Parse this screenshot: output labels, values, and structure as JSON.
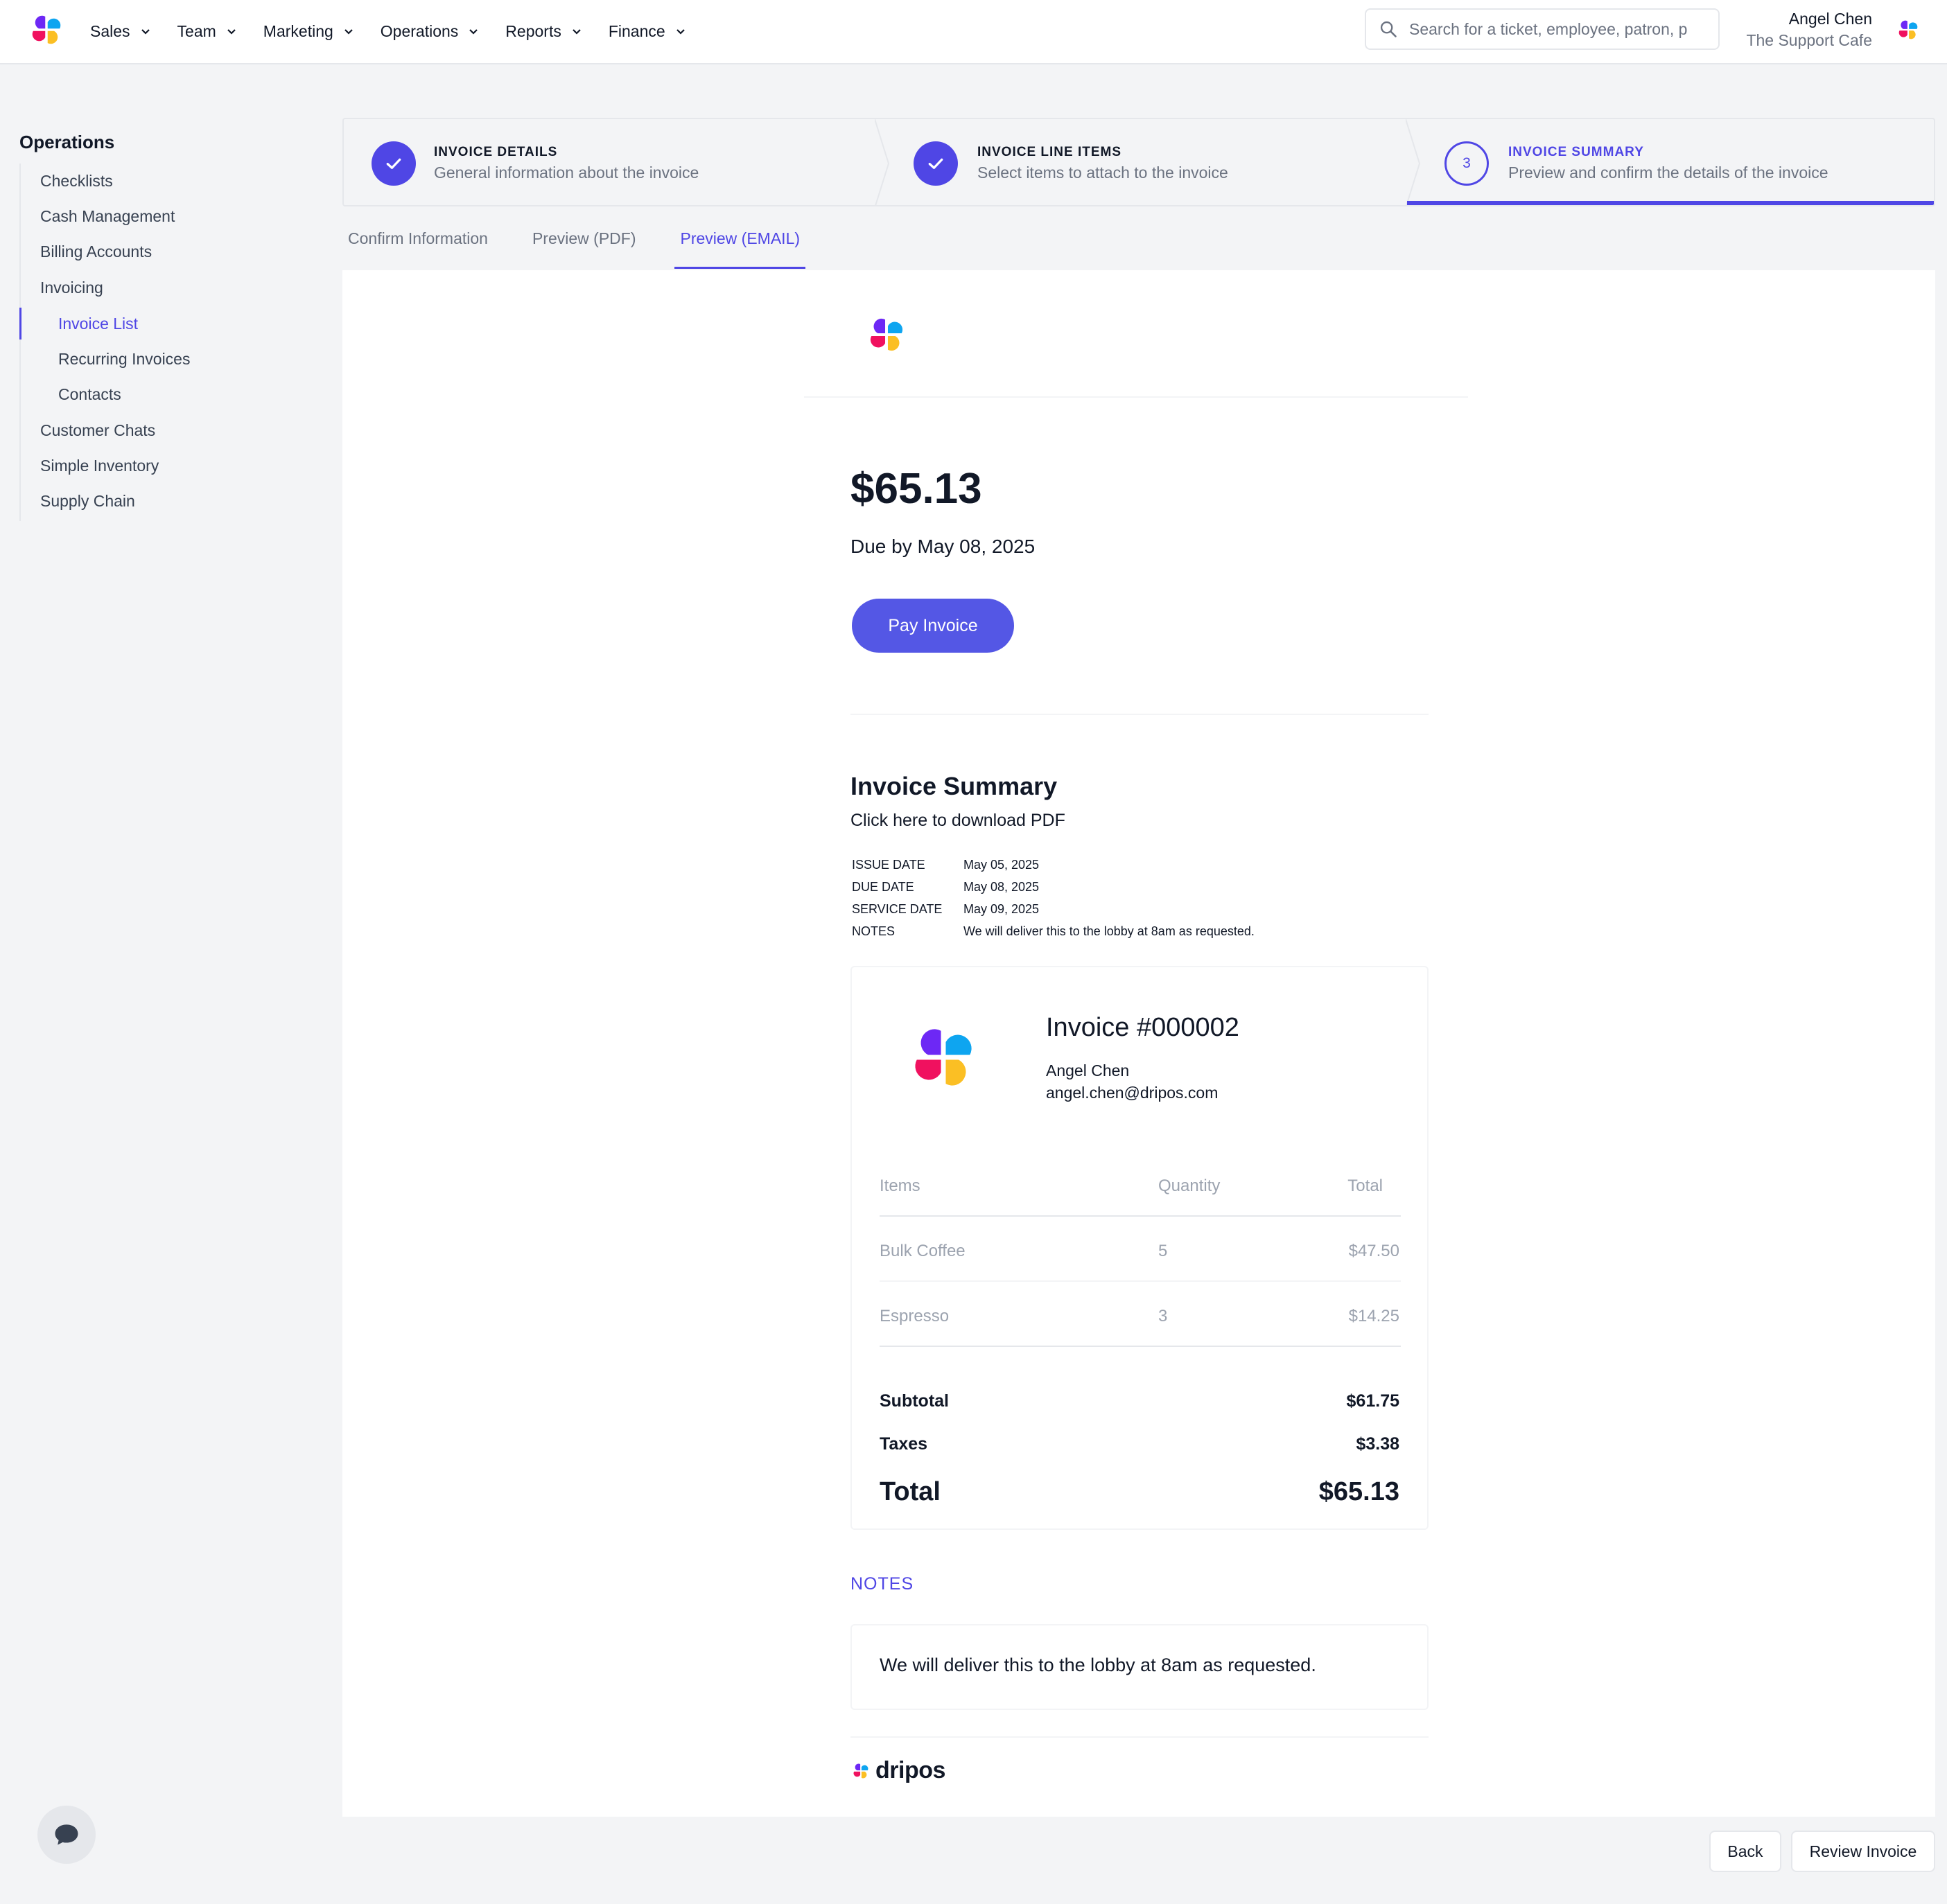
{
  "colors": {
    "accent": "#4f46e5",
    "pay_button": "#5457e5",
    "petal_purple": "#6d28f5",
    "petal_blue": "#0ea5f0",
    "petal_pink": "#f0115f",
    "petal_yellow": "#fbbf24"
  },
  "nav": [
    {
      "label": "Sales"
    },
    {
      "label": "Team"
    },
    {
      "label": "Marketing"
    },
    {
      "label": "Operations"
    },
    {
      "label": "Reports"
    },
    {
      "label": "Finance"
    }
  ],
  "search": {
    "placeholder": "Search for a ticket, employee, patron, p"
  },
  "user": {
    "name": "Angel Chen",
    "org": "The Support Cafe"
  },
  "sidebar": {
    "title": "Operations",
    "items": [
      {
        "label": "Checklists"
      },
      {
        "label": "Cash Management"
      },
      {
        "label": "Billing Accounts"
      },
      {
        "label": "Invoicing"
      },
      {
        "label": "Invoice List"
      },
      {
        "label": "Recurring Invoices"
      },
      {
        "label": "Contacts"
      },
      {
        "label": "Customer Chats"
      },
      {
        "label": "Simple Inventory"
      },
      {
        "label": "Supply Chain"
      }
    ]
  },
  "steps": [
    {
      "title": "INVOICE DETAILS",
      "desc": "General information about the invoice",
      "status": "complete"
    },
    {
      "title": "INVOICE LINE ITEMS",
      "desc": "Select items to attach to the invoice",
      "status": "complete"
    },
    {
      "number": "3",
      "title": "INVOICE SUMMARY",
      "desc": "Preview and confirm the details of the invoice",
      "status": "current"
    }
  ],
  "tabs": [
    {
      "label": "Confirm Information"
    },
    {
      "label": "Preview (PDF)"
    },
    {
      "label": "Preview (EMAIL)"
    }
  ],
  "email": {
    "amount": "$65.13",
    "due": "Due by May 08, 2025",
    "pay_button": "Pay Invoice",
    "summary_title": "Invoice Summary",
    "download_link": "Click here to download PDF",
    "meta": [
      {
        "key": "ISSUE DATE",
        "value": "May 05, 2025"
      },
      {
        "key": "DUE DATE",
        "value": "May 08, 2025"
      },
      {
        "key": "SERVICE DATE",
        "value": "May 09, 2025"
      },
      {
        "key": "NOTES",
        "value": "We will deliver this to the lobby at 8am as requested."
      }
    ],
    "invoice": {
      "number": "Invoice #000002",
      "customer_name": "Angel Chen",
      "customer_email": "angel.chen@dripos.com",
      "headers": {
        "items": "Items",
        "quantity": "Quantity",
        "total": "Total"
      },
      "rows": [
        {
          "item": "Bulk Coffee",
          "quantity": "5",
          "total": "$47.50"
        },
        {
          "item": "Espresso",
          "quantity": "3",
          "total": "$14.25"
        }
      ],
      "subtotal_label": "Subtotal",
      "subtotal": "$61.75",
      "taxes_label": "Taxes",
      "taxes": "$3.38",
      "total_label": "Total",
      "total": "$65.13"
    },
    "notes_label": "NOTES",
    "notes_text": "We will deliver this to the lobby at 8am as requested.",
    "footer_brand": "dripos"
  },
  "actions": {
    "back": "Back",
    "review": "Review Invoice"
  }
}
